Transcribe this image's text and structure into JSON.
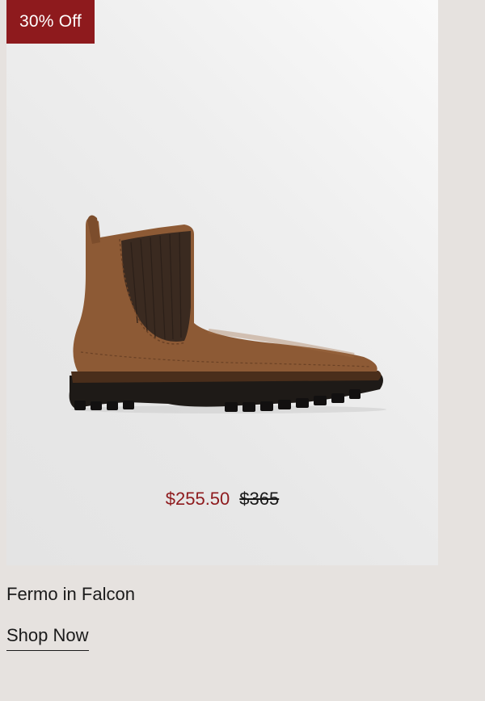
{
  "badge": {
    "label": "30% Off"
  },
  "product": {
    "name": "Fermo in Falcon",
    "sale_price": "$255.50",
    "original_price": "$365",
    "image_icon": "chelsea-boot-icon"
  },
  "cta": {
    "label": "Shop Now"
  },
  "colors": {
    "page_background": "#e6e2df",
    "accent": "#8e1a1d",
    "boot_leather": "#8d5a35",
    "boot_elastic": "#3a2a20",
    "sole": "#1e1a17"
  }
}
